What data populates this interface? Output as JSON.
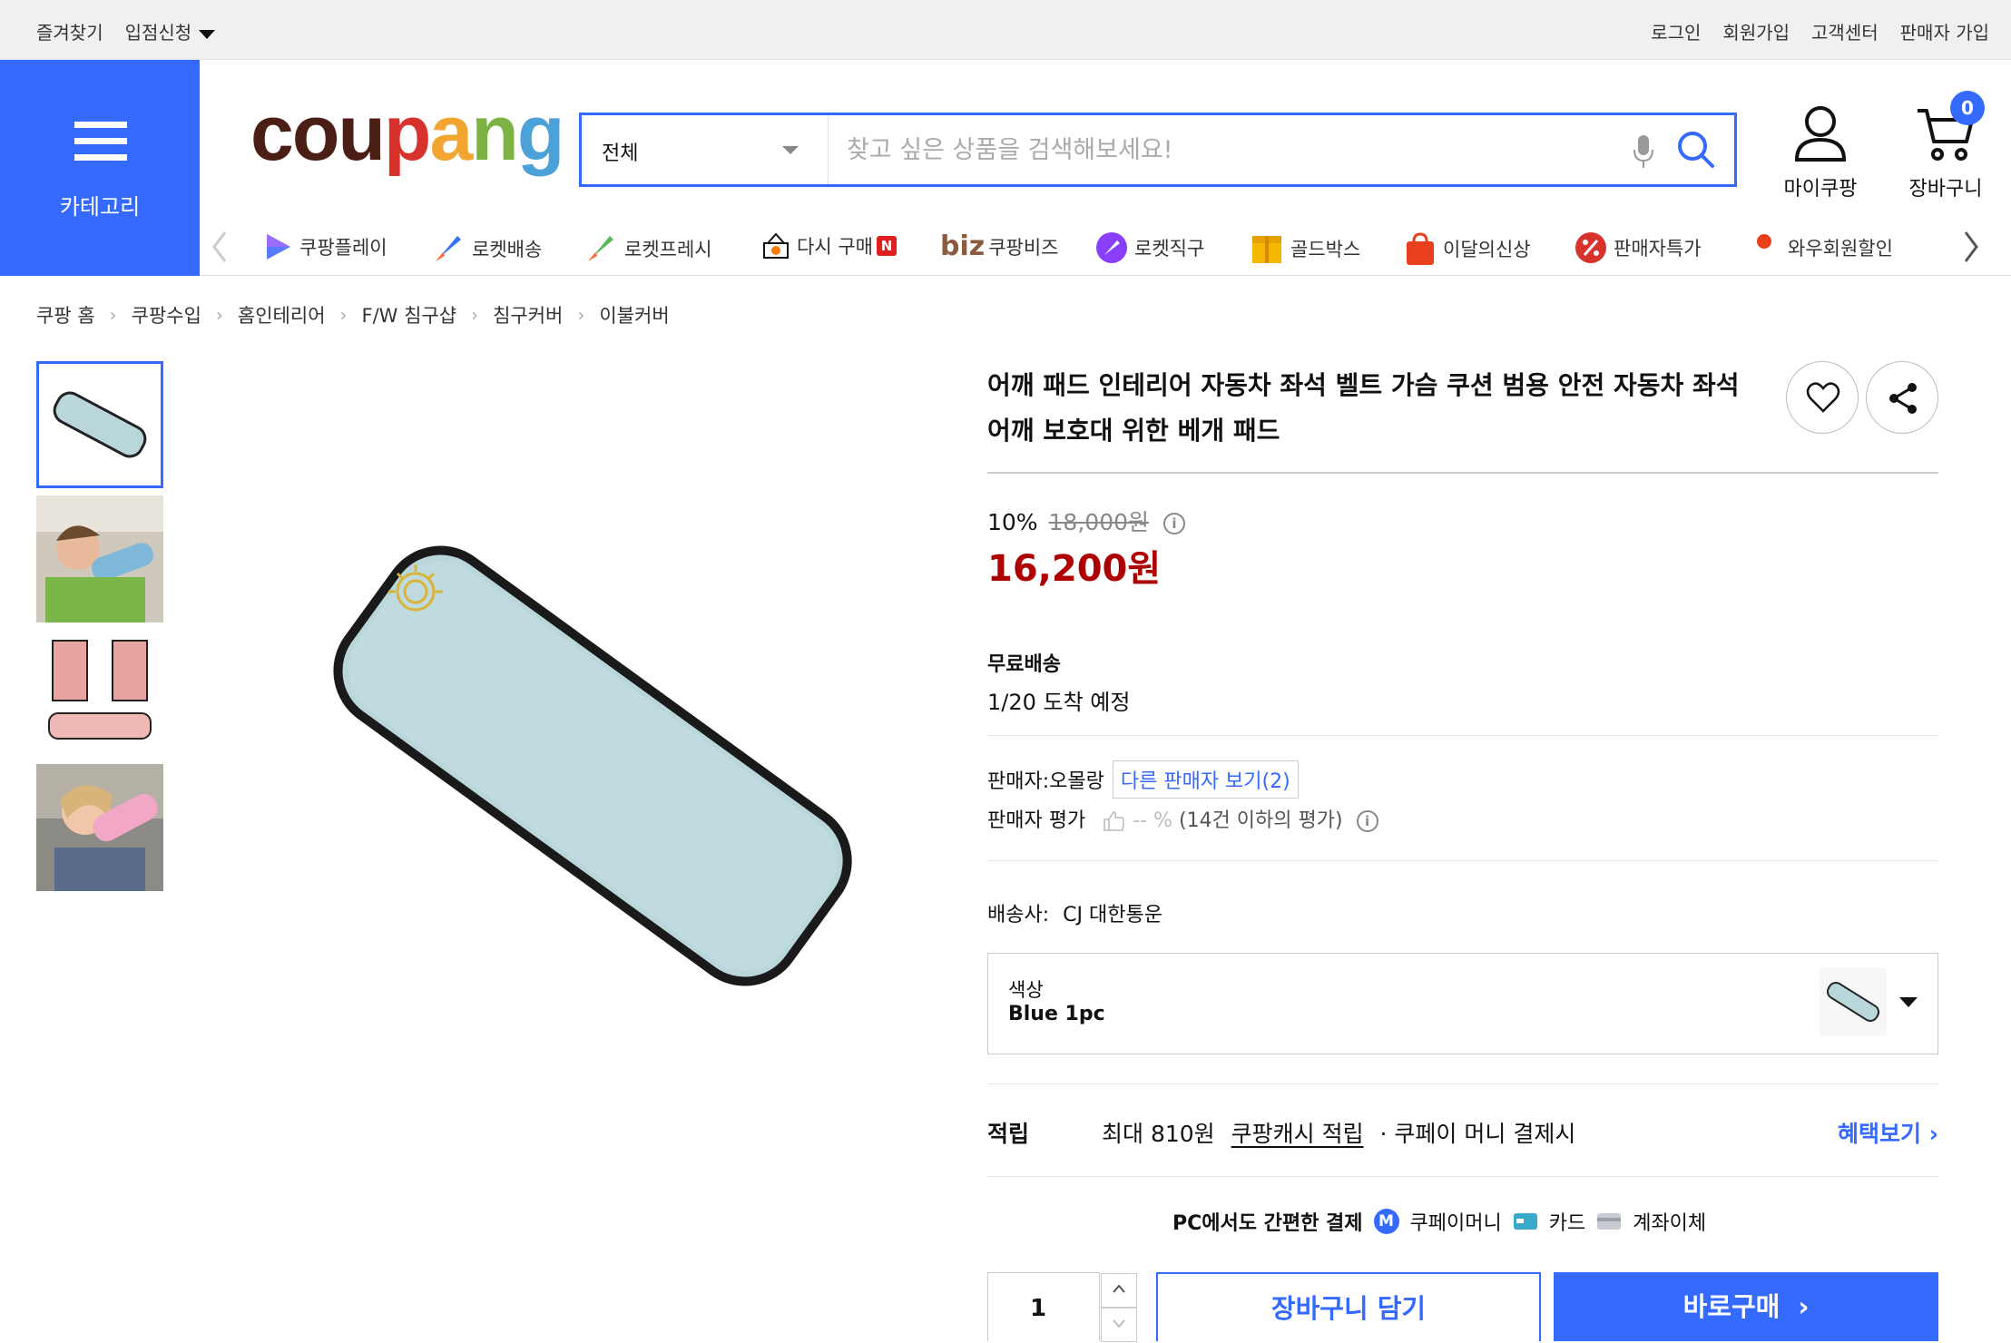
{
  "topbar": {
    "bookmark": "즐겨찾기",
    "store_apply": "입점신청",
    "login": "로그인",
    "signup": "회원가입",
    "customer_center": "고객센터",
    "seller_signup": "판매자 가입"
  },
  "header": {
    "category_label": "카테고리",
    "logo_text": "coupang",
    "search_category": "전체",
    "search_placeholder": "찾고 싶은 상품을 검색해보세요!",
    "my_coupang": "마이쿠팡",
    "cart": "장바구니",
    "cart_count": "0"
  },
  "nav": {
    "items": [
      {
        "label": "쿠팡플레이",
        "icon": "play-icon"
      },
      {
        "label": "로켓배송",
        "icon": "rocket-icon"
      },
      {
        "label": "로켓프레시",
        "icon": "rocket-fresh-icon"
      },
      {
        "label": "다시 구매",
        "icon": "rebuy-icon",
        "badge": "N"
      },
      {
        "label": "쿠팡비즈",
        "icon": "biz-logo",
        "prefix": "biz"
      },
      {
        "label": "로켓직구",
        "icon": "rocket-global-icon"
      },
      {
        "label": "골드박스",
        "icon": "goldbox-icon"
      },
      {
        "label": "이달의신상",
        "icon": "new-bag-icon"
      },
      {
        "label": "판매자특가",
        "icon": "percent-icon"
      },
      {
        "label": "와우회원할인",
        "icon": "wow-icon"
      }
    ]
  },
  "breadcrumb": [
    "쿠팡 홈",
    "쿠팡수입",
    "홈인테리어",
    "F/W 침구샵",
    "침구커버",
    "이불커버"
  ],
  "product": {
    "title": "어깨 패드 인테리어 자동차 좌석 벨트 가슴 쿠션 범용 안전 자동차 좌석 어깨 보호대 위한 베개 패드",
    "discount_rate": "10%",
    "original_price": "18,000원",
    "price": "16,200원",
    "shipping_label": "무료배송",
    "arrival": "1/20 도착 예정",
    "seller_prefix": "판매자:",
    "seller": "오몰랑",
    "other_sellers": "다른 판매자 보기(2)",
    "rating_label": "판매자 평가",
    "rating_value": "-- %",
    "rating_note": "(14건 이하의 평가)",
    "carrier_label": "배송사:",
    "carrier": "CJ 대한통운",
    "option_label": "색상",
    "option_value": "Blue 1pc",
    "reward_label": "적립",
    "reward_text": "최대 810원",
    "reward_link": "쿠팡캐시 적립",
    "reward_suffix": "· 쿠페이 머니 결제시",
    "benefit_link": "혜택보기",
    "pay_title": "PC에서도 간편한 결제",
    "pay_money": "쿠페이머니",
    "pay_card": "카드",
    "pay_bank": "계좌이체",
    "quantity": "1",
    "add_to_cart": "장바구니 담기",
    "buy_now": "바로구매"
  },
  "colors": {
    "accent": "#346aff",
    "price": "#ae0000",
    "pillow": "#b9d6da"
  }
}
